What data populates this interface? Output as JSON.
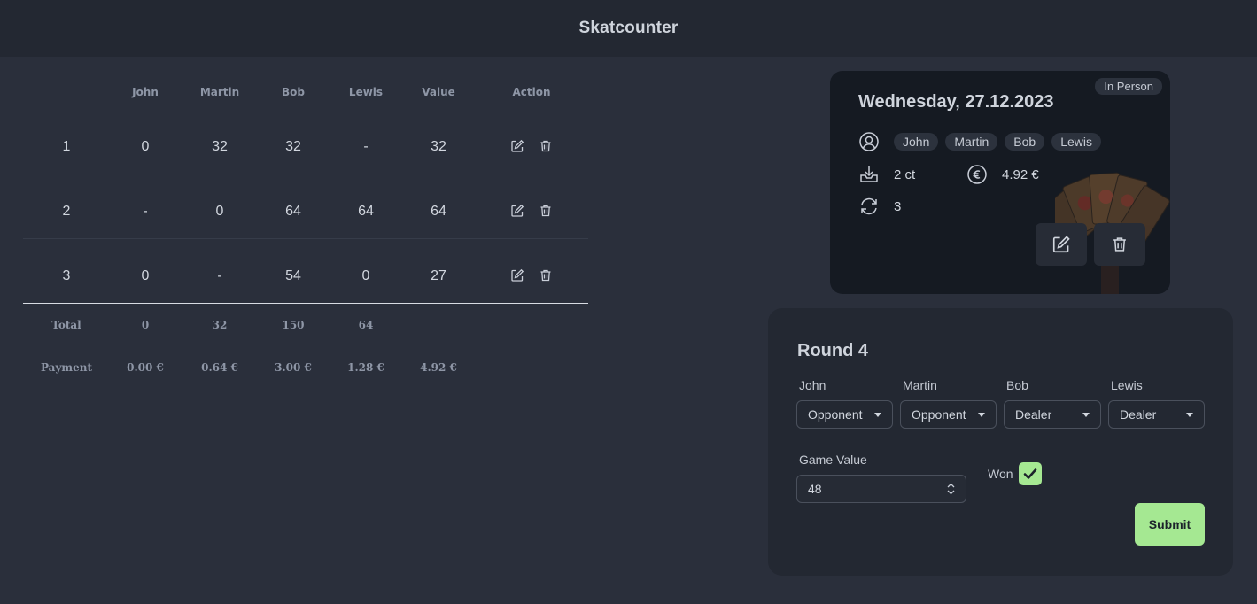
{
  "app": {
    "title": "Skatcounter"
  },
  "table": {
    "headers": [
      "",
      "John",
      "Martin",
      "Bob",
      "Lewis",
      "Value",
      "Action"
    ],
    "rows": [
      {
        "num": "1",
        "cells": [
          "0",
          "32",
          "32",
          "-",
          "32"
        ]
      },
      {
        "num": "2",
        "cells": [
          "-",
          "0",
          "64",
          "64",
          "64"
        ]
      },
      {
        "num": "3",
        "cells": [
          "0",
          "-",
          "54",
          "0",
          "27"
        ]
      }
    ],
    "total": {
      "label": "Total",
      "cells": [
        "0",
        "32",
        "150",
        "64"
      ]
    },
    "payment": {
      "label": "Payment",
      "cells": [
        "0.00 €",
        "0.64 €",
        "3.00 €",
        "1.28 €",
        "4.92 €"
      ]
    }
  },
  "session": {
    "badge": "In Person",
    "date": "Wednesday, 27.12.2023",
    "players": [
      "John",
      "Martin",
      "Bob",
      "Lewis"
    ],
    "stake": "2 ct",
    "total_payment": "4.92 €",
    "rounds": "3"
  },
  "round_form": {
    "title": "Round 4",
    "players": [
      {
        "name": "John",
        "role": "Opponent"
      },
      {
        "name": "Martin",
        "role": "Opponent"
      },
      {
        "name": "Bob",
        "role": "Dealer"
      },
      {
        "name": "Lewis",
        "role": "Dealer"
      }
    ],
    "game_value_label": "Game Value",
    "game_value": "48",
    "won_label": "Won",
    "won_checked": true,
    "submit_label": "Submit"
  },
  "colors": {
    "background": "#2a2f3b",
    "topbar": "#232832",
    "card": "#151a22",
    "accent_green": "#a5e892"
  }
}
